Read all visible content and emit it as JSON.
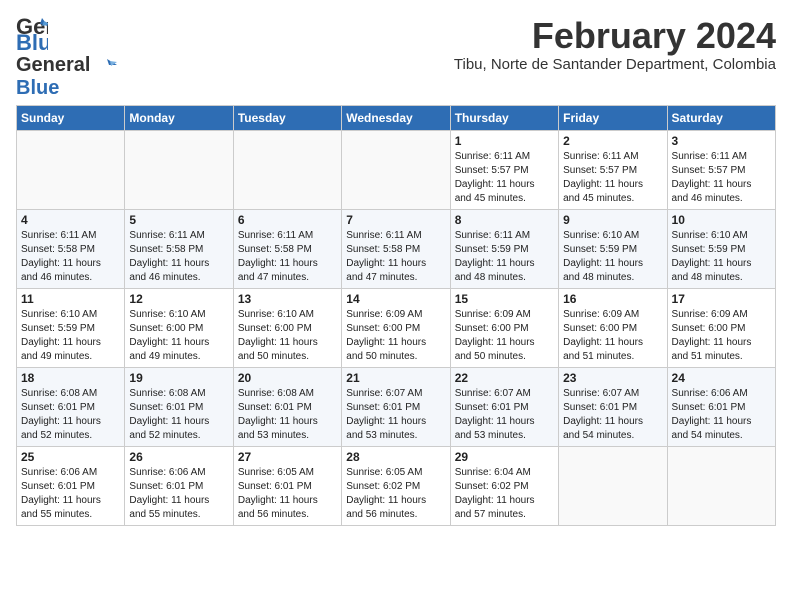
{
  "header": {
    "logo_general": "General",
    "logo_blue": "Blue",
    "month_title": "February 2024",
    "location": "Tibu, Norte de Santander Department, Colombia"
  },
  "weekdays": [
    "Sunday",
    "Monday",
    "Tuesday",
    "Wednesday",
    "Thursday",
    "Friday",
    "Saturday"
  ],
  "weeks": [
    [
      {
        "day": "",
        "info": ""
      },
      {
        "day": "",
        "info": ""
      },
      {
        "day": "",
        "info": ""
      },
      {
        "day": "",
        "info": ""
      },
      {
        "day": "1",
        "info": "Sunrise: 6:11 AM\nSunset: 5:57 PM\nDaylight: 11 hours\nand 45 minutes."
      },
      {
        "day": "2",
        "info": "Sunrise: 6:11 AM\nSunset: 5:57 PM\nDaylight: 11 hours\nand 45 minutes."
      },
      {
        "day": "3",
        "info": "Sunrise: 6:11 AM\nSunset: 5:57 PM\nDaylight: 11 hours\nand 46 minutes."
      }
    ],
    [
      {
        "day": "4",
        "info": "Sunrise: 6:11 AM\nSunset: 5:58 PM\nDaylight: 11 hours\nand 46 minutes."
      },
      {
        "day": "5",
        "info": "Sunrise: 6:11 AM\nSunset: 5:58 PM\nDaylight: 11 hours\nand 46 minutes."
      },
      {
        "day": "6",
        "info": "Sunrise: 6:11 AM\nSunset: 5:58 PM\nDaylight: 11 hours\nand 47 minutes."
      },
      {
        "day": "7",
        "info": "Sunrise: 6:11 AM\nSunset: 5:58 PM\nDaylight: 11 hours\nand 47 minutes."
      },
      {
        "day": "8",
        "info": "Sunrise: 6:11 AM\nSunset: 5:59 PM\nDaylight: 11 hours\nand 48 minutes."
      },
      {
        "day": "9",
        "info": "Sunrise: 6:10 AM\nSunset: 5:59 PM\nDaylight: 11 hours\nand 48 minutes."
      },
      {
        "day": "10",
        "info": "Sunrise: 6:10 AM\nSunset: 5:59 PM\nDaylight: 11 hours\nand 48 minutes."
      }
    ],
    [
      {
        "day": "11",
        "info": "Sunrise: 6:10 AM\nSunset: 5:59 PM\nDaylight: 11 hours\nand 49 minutes."
      },
      {
        "day": "12",
        "info": "Sunrise: 6:10 AM\nSunset: 6:00 PM\nDaylight: 11 hours\nand 49 minutes."
      },
      {
        "day": "13",
        "info": "Sunrise: 6:10 AM\nSunset: 6:00 PM\nDaylight: 11 hours\nand 50 minutes."
      },
      {
        "day": "14",
        "info": "Sunrise: 6:09 AM\nSunset: 6:00 PM\nDaylight: 11 hours\nand 50 minutes."
      },
      {
        "day": "15",
        "info": "Sunrise: 6:09 AM\nSunset: 6:00 PM\nDaylight: 11 hours\nand 50 minutes."
      },
      {
        "day": "16",
        "info": "Sunrise: 6:09 AM\nSunset: 6:00 PM\nDaylight: 11 hours\nand 51 minutes."
      },
      {
        "day": "17",
        "info": "Sunrise: 6:09 AM\nSunset: 6:00 PM\nDaylight: 11 hours\nand 51 minutes."
      }
    ],
    [
      {
        "day": "18",
        "info": "Sunrise: 6:08 AM\nSunset: 6:01 PM\nDaylight: 11 hours\nand 52 minutes."
      },
      {
        "day": "19",
        "info": "Sunrise: 6:08 AM\nSunset: 6:01 PM\nDaylight: 11 hours\nand 52 minutes."
      },
      {
        "day": "20",
        "info": "Sunrise: 6:08 AM\nSunset: 6:01 PM\nDaylight: 11 hours\nand 53 minutes."
      },
      {
        "day": "21",
        "info": "Sunrise: 6:07 AM\nSunset: 6:01 PM\nDaylight: 11 hours\nand 53 minutes."
      },
      {
        "day": "22",
        "info": "Sunrise: 6:07 AM\nSunset: 6:01 PM\nDaylight: 11 hours\nand 53 minutes."
      },
      {
        "day": "23",
        "info": "Sunrise: 6:07 AM\nSunset: 6:01 PM\nDaylight: 11 hours\nand 54 minutes."
      },
      {
        "day": "24",
        "info": "Sunrise: 6:06 AM\nSunset: 6:01 PM\nDaylight: 11 hours\nand 54 minutes."
      }
    ],
    [
      {
        "day": "25",
        "info": "Sunrise: 6:06 AM\nSunset: 6:01 PM\nDaylight: 11 hours\nand 55 minutes."
      },
      {
        "day": "26",
        "info": "Sunrise: 6:06 AM\nSunset: 6:01 PM\nDaylight: 11 hours\nand 55 minutes."
      },
      {
        "day": "27",
        "info": "Sunrise: 6:05 AM\nSunset: 6:01 PM\nDaylight: 11 hours\nand 56 minutes."
      },
      {
        "day": "28",
        "info": "Sunrise: 6:05 AM\nSunset: 6:02 PM\nDaylight: 11 hours\nand 56 minutes."
      },
      {
        "day": "29",
        "info": "Sunrise: 6:04 AM\nSunset: 6:02 PM\nDaylight: 11 hours\nand 57 minutes."
      },
      {
        "day": "",
        "info": ""
      },
      {
        "day": "",
        "info": ""
      }
    ]
  ]
}
